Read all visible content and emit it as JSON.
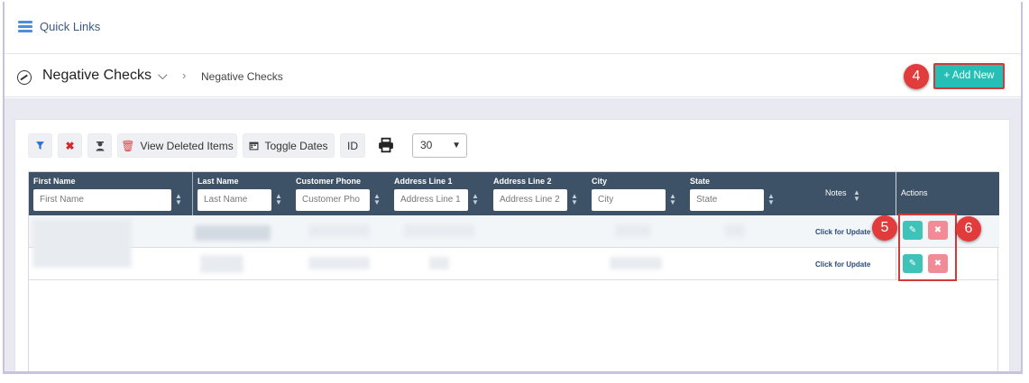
{
  "quick_links": {
    "label": "Quick Links"
  },
  "header": {
    "module_title": "Negative Checks",
    "breadcrumb_sep": "›",
    "breadcrumb": "Negative Checks",
    "add_new": "+ Add New"
  },
  "toolbar": {
    "view_deleted": "View Deleted Items",
    "toggle_dates": "Toggle Dates",
    "id_label": "ID",
    "page_size": "30"
  },
  "table": {
    "columns": [
      {
        "label": "First Name",
        "placeholder": "First Name"
      },
      {
        "label": "Last Name",
        "placeholder": "Last Name"
      },
      {
        "label": "Customer Phone",
        "placeholder": "Customer Pho"
      },
      {
        "label": "Address Line 1",
        "placeholder": "Address Line 1"
      },
      {
        "label": "Address Line 2",
        "placeholder": "Address Line 2"
      },
      {
        "label": "City",
        "placeholder": "City"
      },
      {
        "label": "State",
        "placeholder": "State"
      },
      {
        "label": "Notes"
      },
      {
        "label": "Actions"
      }
    ],
    "rows": [
      {
        "notes": "Click for Update"
      },
      {
        "notes": "Click for Update"
      }
    ]
  },
  "callouts": {
    "add": "4",
    "edit": "5",
    "delete": "6"
  },
  "colors": {
    "accent": "#26bfb5",
    "header_bg": "#3d5266",
    "callout": "#e23b3b",
    "delete": "#f28b96"
  }
}
